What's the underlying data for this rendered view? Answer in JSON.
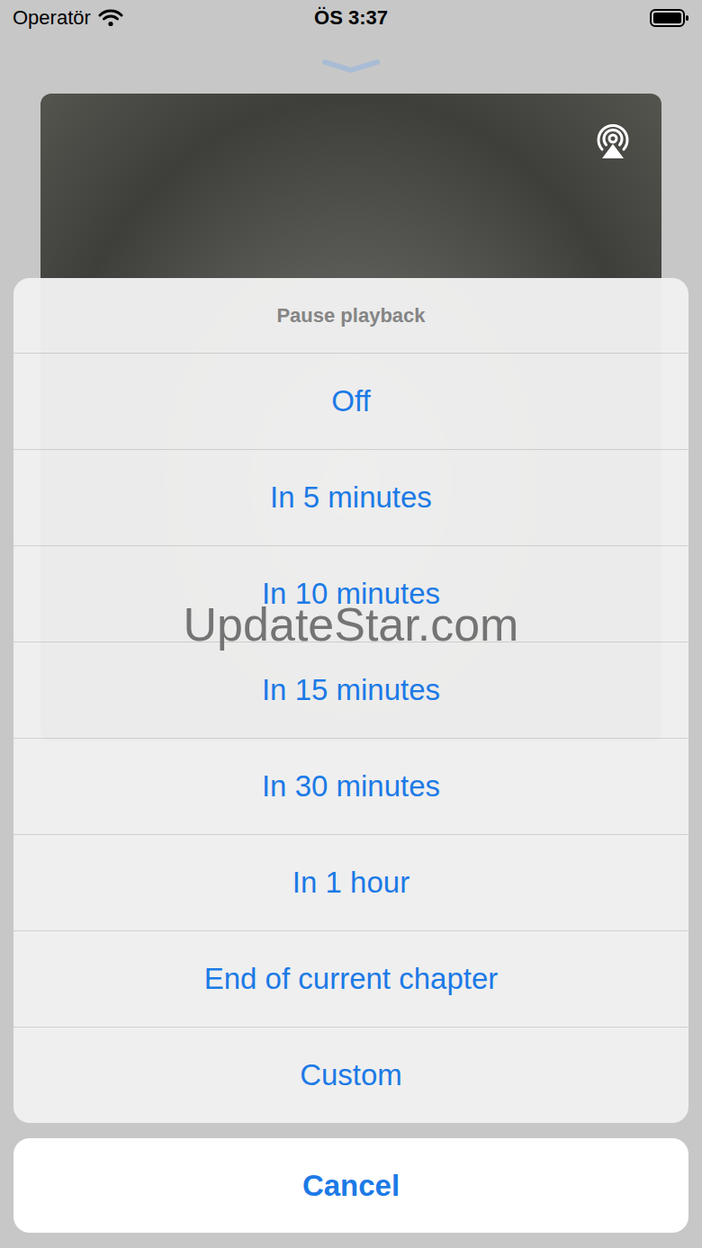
{
  "status_bar": {
    "carrier": "Operatör",
    "time": "ÖS 3:37",
    "battery": {
      "level": 1
    }
  },
  "action_sheet": {
    "title": "Pause playback",
    "options": [
      {
        "label": "Off"
      },
      {
        "label": "In 5 minutes"
      },
      {
        "label": "In 10 minutes"
      },
      {
        "label": "In 15 minutes"
      },
      {
        "label": "In 30 minutes"
      },
      {
        "label": "In 1 hour"
      },
      {
        "label": "End of current chapter"
      },
      {
        "label": "Custom"
      }
    ],
    "cancel": "Cancel"
  },
  "watermark": "UpdateStar.com"
}
